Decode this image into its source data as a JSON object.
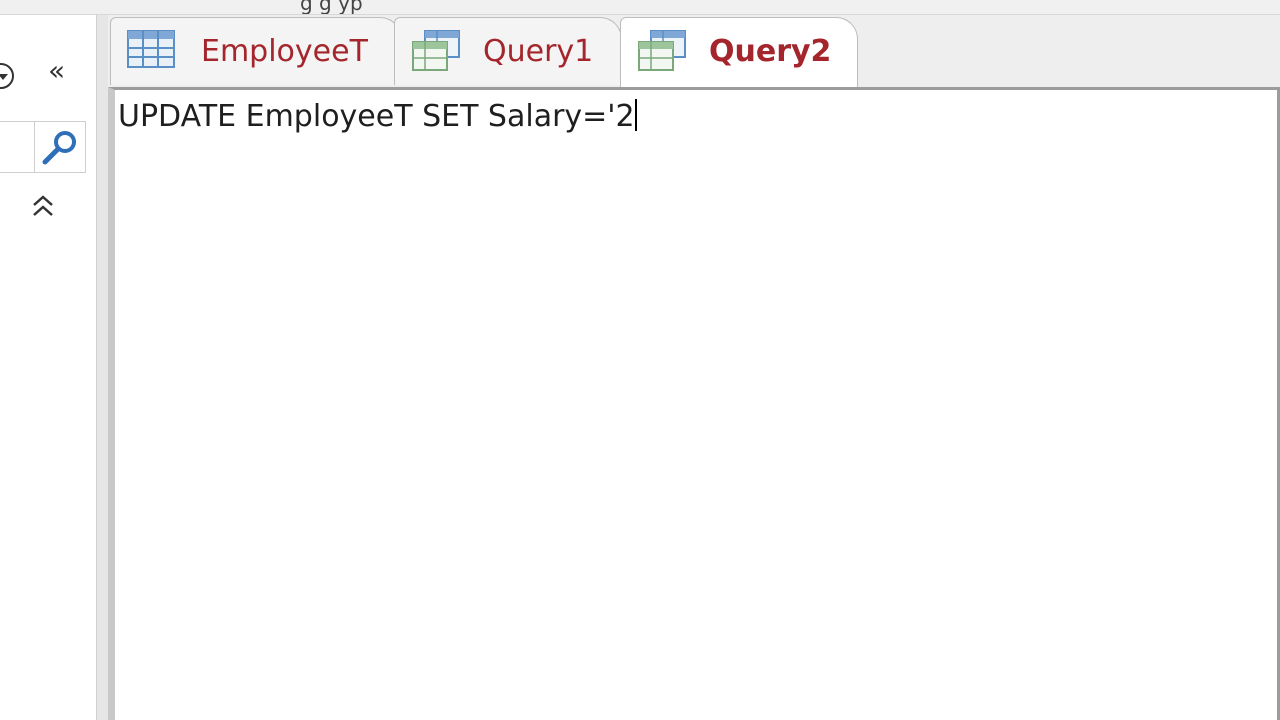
{
  "window": {
    "partial_title": "g g yp"
  },
  "navigation": {
    "shutter_glyph": "«",
    "collapse_glyph": "⌃",
    "search_placeholder": ""
  },
  "tabs": [
    {
      "label": "EmployeeT",
      "icon": "table-icon",
      "active": false
    },
    {
      "label": "Query1",
      "icon": "query-icon",
      "active": false
    },
    {
      "label": "Query2",
      "icon": "query-icon",
      "active": true
    }
  ],
  "editor": {
    "sql": "UPDATE EmployeeT SET Salary='2"
  },
  "colors": {
    "tab_label": "#a4262c",
    "tab_strip": "#eeeeee",
    "icon_blue": "#5a8fc6",
    "icon_green": "#7aa87a"
  }
}
